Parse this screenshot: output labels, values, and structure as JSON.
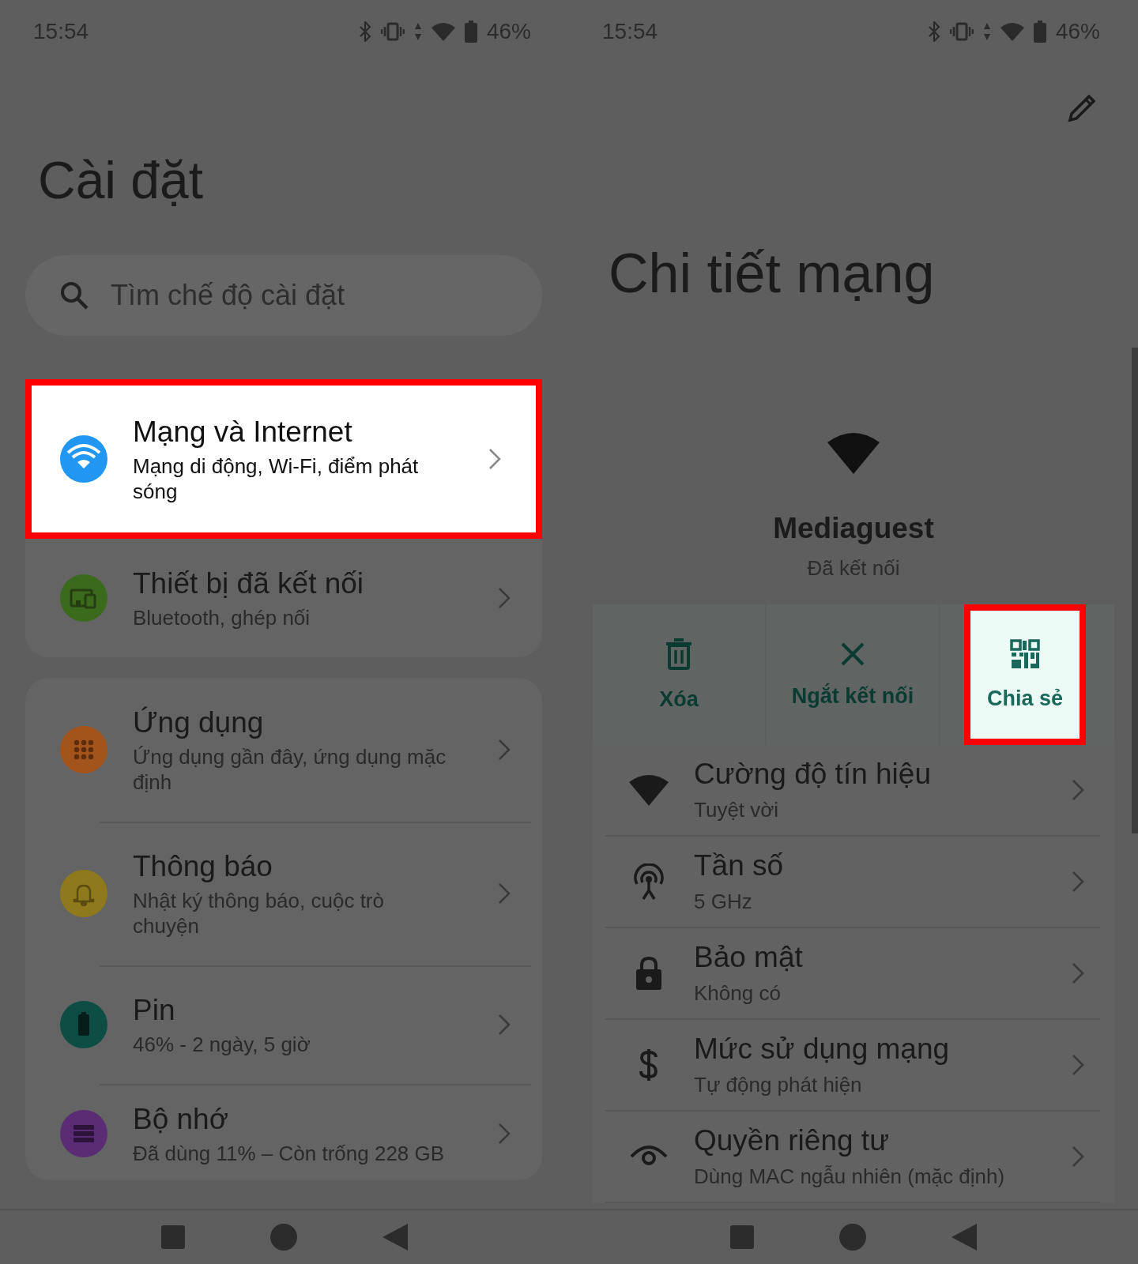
{
  "settings_screen": {
    "status_bar": {
      "time": "15:54",
      "battery": "46%"
    },
    "title": "Cài đặt",
    "search": {
      "placeholder": "Tìm chế độ cài đặt"
    },
    "groups": [
      [
        {
          "title": "Mạng và Internet",
          "subtitle": "Mạng di động, Wi-Fi, điểm phát sóng",
          "color": "#2196f3",
          "highlighted": true
        },
        {
          "title": "Thiết bị đã kết nối",
          "subtitle": "Bluetooth, ghép nối",
          "color": "#3b6a1c",
          "highlighted": false
        }
      ],
      [
        {
          "title": "Ứng dụng",
          "subtitle": "Ứng dụng gần đây, ứng dụng mặc định",
          "color": "#a3541a",
          "highlighted": false
        },
        {
          "title": "Thông báo",
          "subtitle": "Nhật ký thông báo, cuộc trò chuyện",
          "color": "#8e7a1c",
          "highlighted": false
        },
        {
          "title": "Pin",
          "subtitle": "46% - 2 ngày, 5 giờ",
          "color": "#0d4d44",
          "highlighted": false
        },
        {
          "title": "Bộ nhớ",
          "subtitle": "Đã dùng 11% – Còn trống 228 GB",
          "color": "#5a2c74",
          "highlighted": false
        }
      ]
    ]
  },
  "network_screen": {
    "status_bar": {
      "time": "15:54",
      "battery": "46%"
    },
    "title": "Chi tiết mạng",
    "network": {
      "name": "Mediaguest",
      "status": "Đã kết nối"
    },
    "actions": [
      {
        "label": "Xóa",
        "highlighted": false
      },
      {
        "label": "Ngắt kết nối",
        "highlighted": false
      },
      {
        "label": "Chia sẻ",
        "highlighted": true
      }
    ],
    "rows": [
      {
        "title": "Cường độ tín hiệu",
        "subtitle": "Tuyệt vời"
      },
      {
        "title": "Tần số",
        "subtitle": "5 GHz"
      },
      {
        "title": "Bảo mật",
        "subtitle": "Không có"
      },
      {
        "title": "Mức sử dụng mạng",
        "subtitle": "Tự động phát hiện"
      },
      {
        "title": "Quyền riêng tư",
        "subtitle": "Dùng MAC ngẫu nhiên (mặc định)"
      }
    ]
  }
}
